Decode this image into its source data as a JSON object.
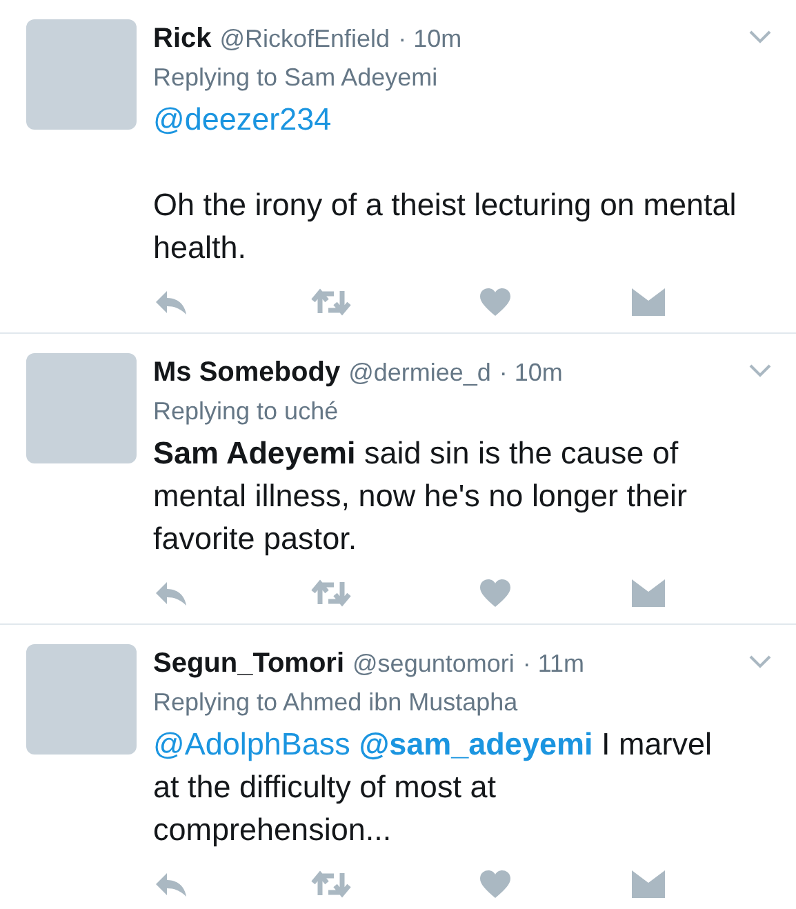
{
  "tweets": [
    {
      "name": "Rick",
      "handle": "@RickofEnfield",
      "time": "· 10m",
      "replying_to": "Replying to Sam Adeyemi",
      "paragraphs": [
        [
          {
            "kind": "link",
            "text": "@deezer234"
          }
        ],
        [
          {
            "kind": "text",
            "text": "Oh the irony of a theist lecturing on mental health."
          }
        ]
      ]
    },
    {
      "name": "Ms Somebody",
      "handle": "@dermiee_d",
      "time": "· 10m",
      "replying_to": "Replying to uché",
      "paragraphs": [
        [
          {
            "kind": "bold",
            "text": "Sam Adeyemi"
          },
          {
            "kind": "text",
            "text": " said sin is the cause of mental illness, now he's no longer their favorite pastor."
          }
        ]
      ]
    },
    {
      "name": "Segun_Tomori",
      "handle": "@seguntomori",
      "time": "· 11m",
      "replying_to": "Replying to Ahmed ibn Mustapha",
      "paragraphs": [
        [
          {
            "kind": "link",
            "text": "@AdolphBass"
          },
          {
            "kind": "link_bold",
            "text": "@sam_adeyemi"
          },
          {
            "kind": "text",
            "text": " I marvel at the difficulty of most at comprehension..."
          }
        ]
      ]
    }
  ]
}
